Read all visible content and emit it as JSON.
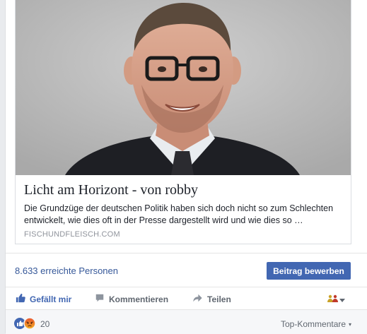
{
  "link_preview": {
    "title": "Licht am Horizont - von robby",
    "description": "Die Grundzüge der deutschen Politik haben sich doch nicht so zum Schlechten entwickelt, wie dies oft in der Presse dargestellt wird und wie dies so …",
    "domain": "FISCHUNDFLEISCH.COM",
    "image": "portrait-photo"
  },
  "stats": {
    "reach": "8.633 erreichte Personen",
    "boost_label": "Beitrag bewerben"
  },
  "actions": {
    "like": "Gefällt mir",
    "comment": "Kommentieren",
    "share": "Teilen"
  },
  "reactions": {
    "count": "20",
    "types": [
      "like",
      "angry"
    ],
    "sort_label": "Top-Kommentare"
  },
  "colors": {
    "accent": "#4267b2",
    "link": "#365899",
    "secondary_text": "#606770"
  }
}
